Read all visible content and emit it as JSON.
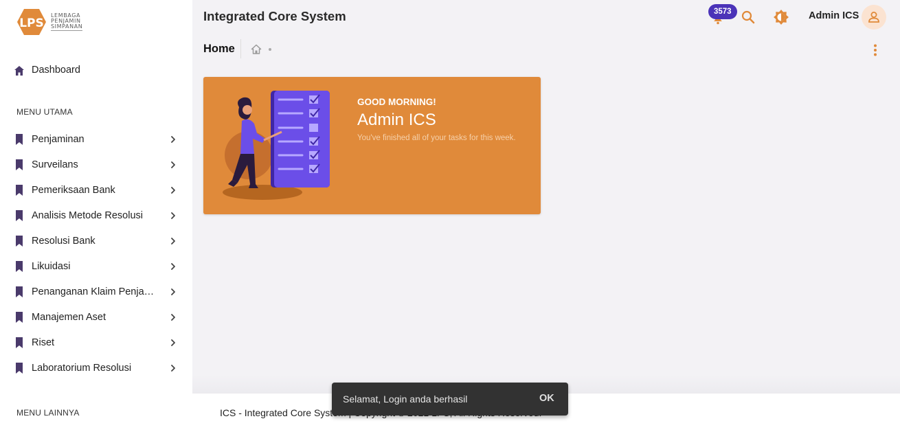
{
  "brand": {
    "logo_letters": "LPS",
    "logo_lines": [
      "LEMBAGA",
      "PENJAMIN",
      "SIMPANAN"
    ],
    "accent_color": "#e08a3a",
    "purple_color": "#4b33b8"
  },
  "sidebar": {
    "dashboard_label": "Dashboard",
    "menu_utama_title": "MENU UTAMA",
    "items": [
      {
        "label": "Penjaminan",
        "icon": "bookmark-icon"
      },
      {
        "label": "Surveilans",
        "icon": "bookmark-icon"
      },
      {
        "label": "Pemeriksaan Bank",
        "icon": "bookmark-icon"
      },
      {
        "label": "Analisis Metode Resolusi",
        "icon": "bookmark-icon"
      },
      {
        "label": "Resolusi Bank",
        "icon": "bookmark-icon"
      },
      {
        "label": "Likuidasi",
        "icon": "bookmark-icon"
      },
      {
        "label": "Penanganan Klaim Penjaminan",
        "icon": "bookmark-icon"
      },
      {
        "label": "Manajemen Aset",
        "icon": "bookmark-icon"
      },
      {
        "label": "Riset",
        "icon": "bookmark-icon"
      },
      {
        "label": "Laboratorium Resolusi",
        "icon": "bookmark-icon"
      }
    ],
    "menu_lainnya_title": "MENU LAINNYA"
  },
  "header": {
    "app_title": "Integrated Core System",
    "notification_count": "3573",
    "user_name": "Admin ICS"
  },
  "breadcrumb": {
    "page_title": "Home"
  },
  "welcome": {
    "greeting": "GOOD MORNING!",
    "name": "Admin ICS",
    "subtitle": "You've finished all of your tasks for this week."
  },
  "footer": {
    "text": "ICS - Integrated Core System | Copyright © 2021 LPS, All Rights Reserved."
  },
  "snackbar": {
    "message": "Selamat, Login anda berhasil",
    "action": "OK"
  }
}
